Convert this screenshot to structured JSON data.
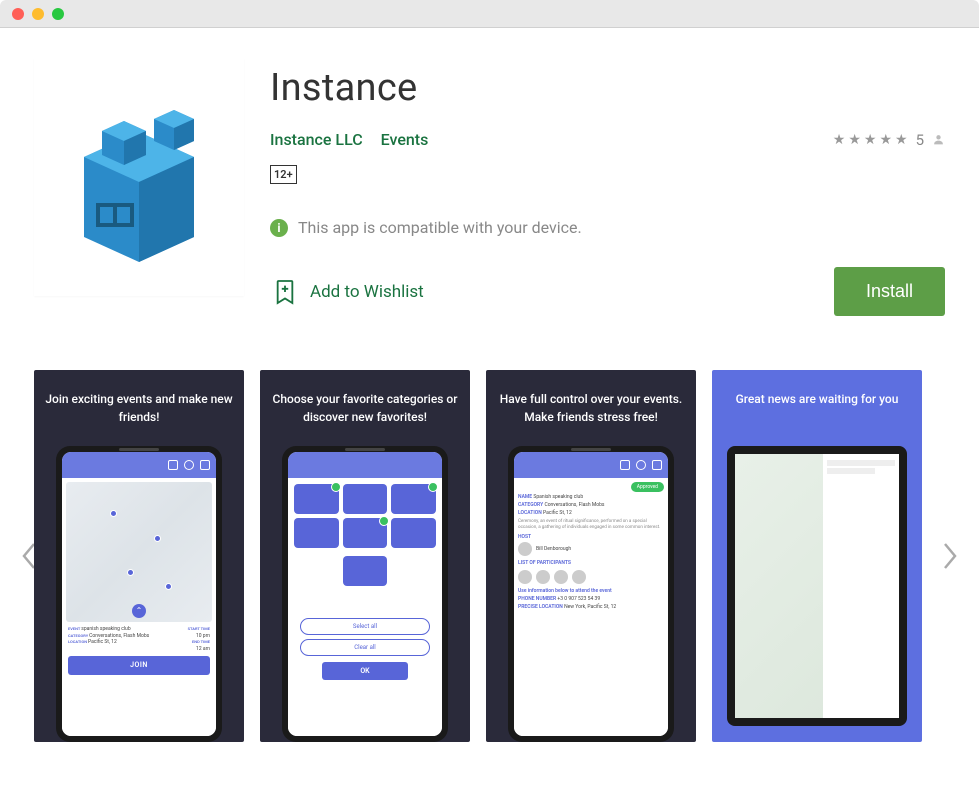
{
  "app": {
    "title": "Instance",
    "developer": "Instance LLC",
    "category": "Events",
    "age_rating": "12+",
    "compatibility": "This app is compatible with your device.",
    "wishlist_label": "Add to Wishlist",
    "install_label": "Install",
    "rating_value": "5",
    "star_count": 5
  },
  "screenshots": [
    {
      "caption": "Join exciting events and make new friends!"
    },
    {
      "caption": "Choose your favorite categories or discover new favorites!"
    },
    {
      "caption": "Have full control over your events. Make friends stress free!"
    },
    {
      "caption": "Great news are waiting for you"
    }
  ],
  "slide1": {
    "event_name": "spanish speaking club",
    "category_label": "Conversations, Flash Mobs",
    "location": "Pacific St, 12",
    "start_time": "10 pm",
    "end_time": "12 am",
    "join": "JOIN"
  },
  "slide2": {
    "select_all": "Select all",
    "clear_all": "Clear all",
    "ok": "OK"
  },
  "slide3": {
    "status": "Approved",
    "name": "Spanish speaking club",
    "category": "Conversations, Flash Mobs",
    "location": "Pacific St, 12",
    "description": "Ceremony, an event of ritual significance, performed on a special occasion, a gathering of individuals engaged in some common interest.",
    "host": "Bill Denborough",
    "attend_header": "Use information below to attend the event",
    "phone": "+3 0 907 523 54 39",
    "precise": "New York, Pacific St, 12"
  }
}
